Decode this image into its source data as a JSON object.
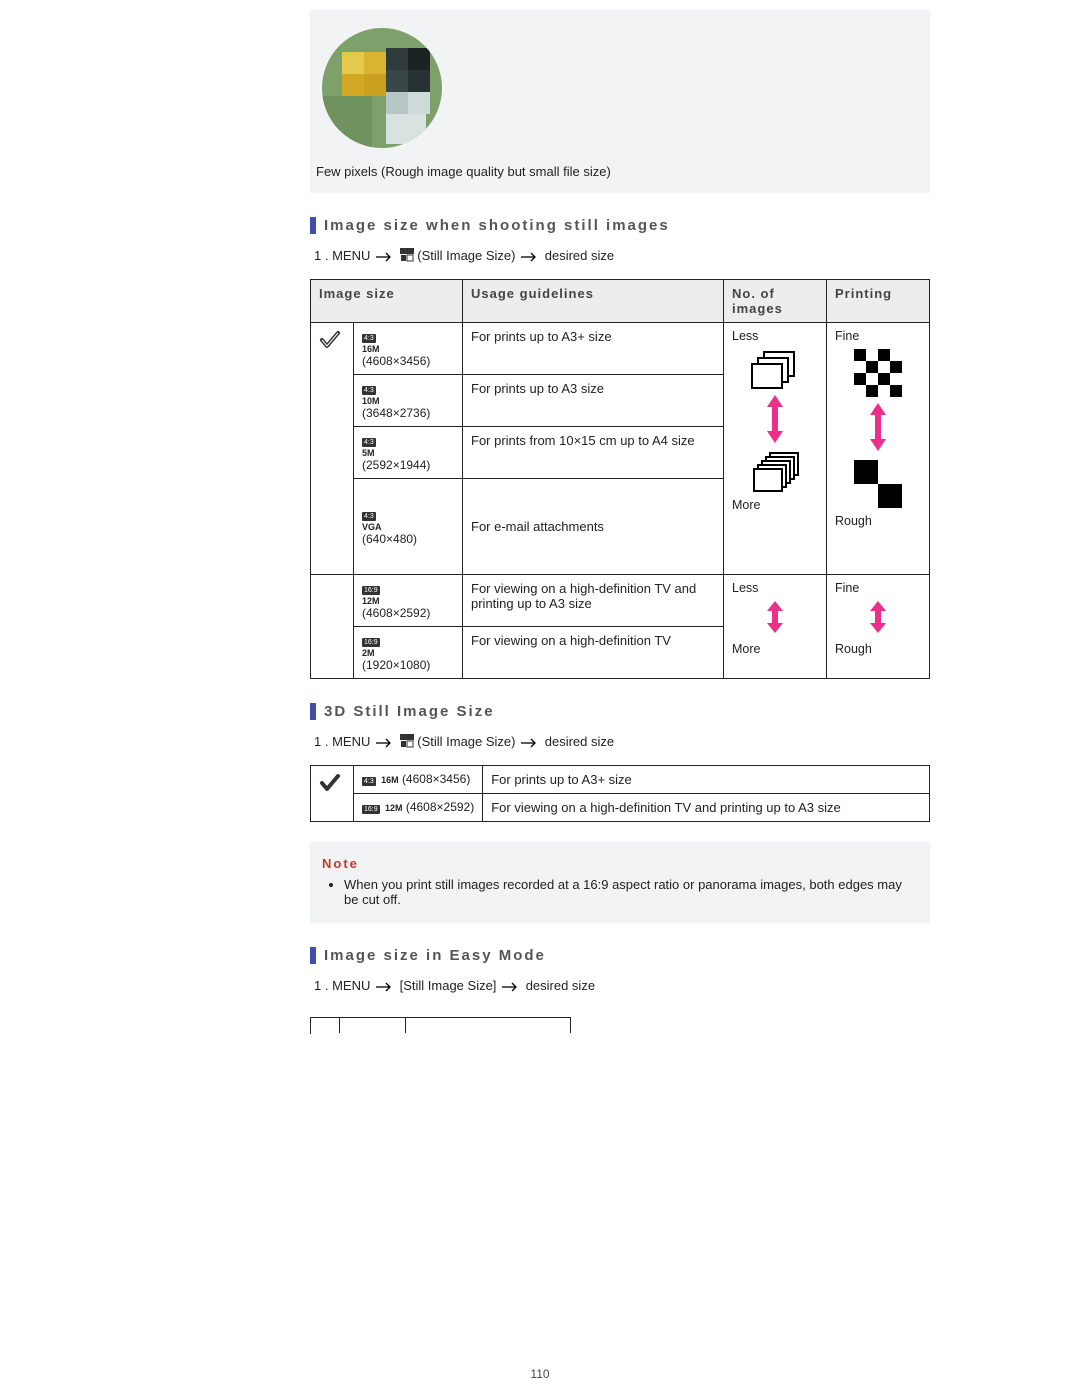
{
  "top_caption": "Few pixels (Rough image quality but small file size)",
  "section1": {
    "title": "Image size when shooting still images",
    "menu_text": "MENU",
    "menu_mid": "(Still Image Size)",
    "menu_end": "desired size",
    "headers": {
      "c1": "Image size",
      "c2": "Usage guidelines",
      "c3": "No. of images",
      "c4": "Printing"
    },
    "rows43": [
      {
        "badge": "4:3",
        "label": "16M",
        "dim": "(4608×3456)",
        "guide": "For prints up to A3+ size"
      },
      {
        "badge": "4:3",
        "label": "10M",
        "dim": "(3648×2736)",
        "guide": "For prints up to A3 size"
      },
      {
        "badge": "4:3",
        "label": "5M",
        "dim": "(2592×1944)",
        "guide": "For prints from 10×15 cm up to A4 size"
      },
      {
        "badge": "4:3",
        "label": "VGA",
        "dim": "(640×480)",
        "guide": "For e-mail attachments"
      }
    ],
    "rows169": [
      {
        "badge": "16:9",
        "label": "12M",
        "dim": "(4608×2592)",
        "guide": "For viewing on a high-definition TV and printing up to A3 size"
      },
      {
        "badge": "16:9",
        "label": "2M",
        "dim": "(1920×1080)",
        "guide": "For viewing on a high-definition TV"
      }
    ],
    "scale": {
      "less": "Less",
      "more": "More",
      "fine": "Fine",
      "rough": "Rough"
    }
  },
  "section2": {
    "title": "3D Still Image Size",
    "menu_text": "MENU",
    "menu_mid": "(Still Image Size)",
    "menu_end": "desired size",
    "rows": [
      {
        "badge": "4:3",
        "label": "16M",
        "dim": "(4608×3456)",
        "guide": "For prints up to A3+ size"
      },
      {
        "badge": "16:9",
        "label": "12M",
        "dim": "(4608×2592)",
        "guide": "For viewing on a high-definition TV and printing up to A3 size"
      }
    ]
  },
  "note": {
    "title": "Note",
    "item": "When you print still images recorded at a 16:9 aspect ratio or panorama images, both edges may be cut off."
  },
  "section3": {
    "title": "Image size in Easy Mode",
    "menu_text": "MENU",
    "menu_mid": "[Still Image Size]",
    "menu_end": "desired size"
  },
  "page_number": "110"
}
